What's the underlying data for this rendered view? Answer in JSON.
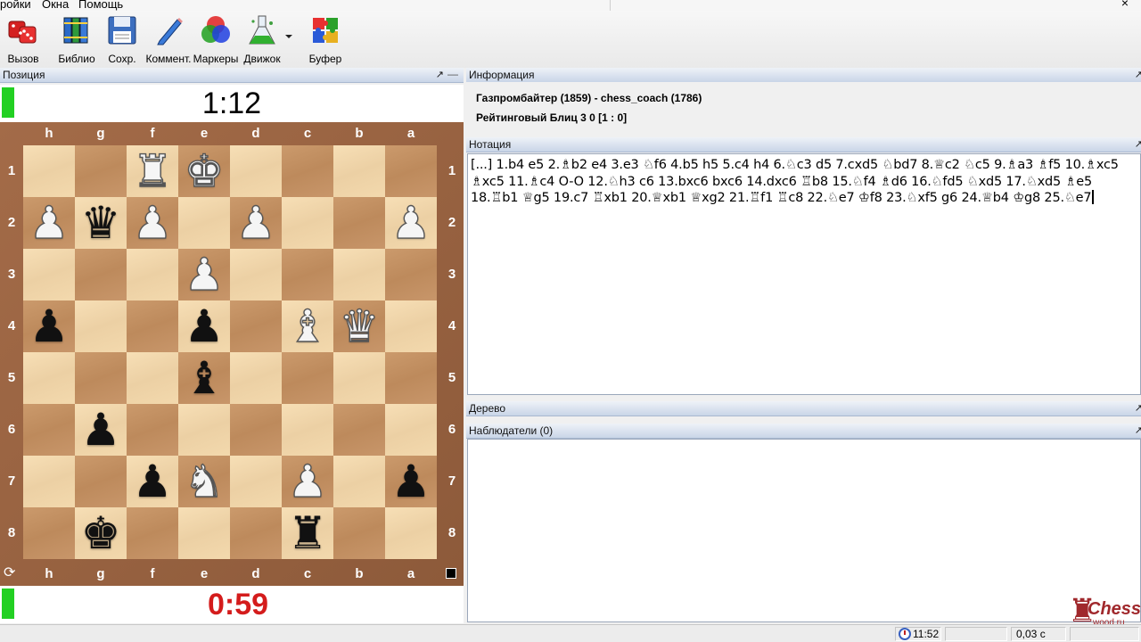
{
  "menu": {
    "items": [
      "ройки",
      "Окна",
      "Помощь"
    ],
    "close_symbol": "×"
  },
  "toolbar": {
    "buttons": [
      {
        "label": "Вызов",
        "icon": "dice-icon"
      },
      {
        "label": "Библио",
        "icon": "books-icon"
      },
      {
        "label": "Сохр.",
        "icon": "floppy-disk-icon"
      },
      {
        "label": "Коммент.",
        "icon": "pencil-icon"
      },
      {
        "label": "Маркеры",
        "icon": "color-circles-icon"
      },
      {
        "label": "Движок",
        "icon": "flask-icon"
      },
      {
        "label": "Буфер",
        "icon": "puzzle-icon"
      }
    ]
  },
  "position_panel": {
    "title": "Позиция",
    "pin_symbol": "↗",
    "clock_top": "1:12",
    "clock_bottom": "0:59",
    "files": [
      "h",
      "g",
      "f",
      "e",
      "d",
      "c",
      "b",
      "a"
    ],
    "ranks": [
      "1",
      "2",
      "3",
      "4",
      "5",
      "6",
      "7",
      "8"
    ],
    "pieces": [
      {
        "square": "f1",
        "color": "w",
        "type": "rook",
        "glyph": "♜"
      },
      {
        "square": "e1",
        "color": "w",
        "type": "king",
        "glyph": "♚"
      },
      {
        "square": "h2",
        "color": "w",
        "type": "pawn",
        "glyph": "♟"
      },
      {
        "square": "g2",
        "color": "b",
        "type": "queen",
        "glyph": "♛"
      },
      {
        "square": "f2",
        "color": "w",
        "type": "pawn",
        "glyph": "♟"
      },
      {
        "square": "d2",
        "color": "w",
        "type": "pawn",
        "glyph": "♟"
      },
      {
        "square": "a2",
        "color": "w",
        "type": "pawn",
        "glyph": "♟"
      },
      {
        "square": "e3",
        "color": "w",
        "type": "pawn",
        "glyph": "♟"
      },
      {
        "square": "h4",
        "color": "b",
        "type": "pawn",
        "glyph": "♟"
      },
      {
        "square": "e4",
        "color": "b",
        "type": "pawn",
        "glyph": "♟"
      },
      {
        "square": "c4",
        "color": "w",
        "type": "bishop",
        "glyph": "♝"
      },
      {
        "square": "b4",
        "color": "w",
        "type": "queen",
        "glyph": "♛"
      },
      {
        "square": "e5",
        "color": "b",
        "type": "bishop",
        "glyph": "♝"
      },
      {
        "square": "g6",
        "color": "b",
        "type": "pawn",
        "glyph": "♟"
      },
      {
        "square": "f7",
        "color": "b",
        "type": "pawn",
        "glyph": "♟"
      },
      {
        "square": "e7",
        "color": "w",
        "type": "knight",
        "glyph": "♞"
      },
      {
        "square": "c7",
        "color": "w",
        "type": "pawn",
        "glyph": "♟"
      },
      {
        "square": "a7",
        "color": "b",
        "type": "pawn",
        "glyph": "♟"
      },
      {
        "square": "g8",
        "color": "b",
        "type": "king",
        "glyph": "♚"
      },
      {
        "square": "c8",
        "color": "b",
        "type": "rook",
        "glyph": "♜"
      }
    ]
  },
  "info_panel": {
    "title": "Информация",
    "players": "Газпромбайтер (1859) - chess_coach (1786)",
    "event": "Рейтинговый Блиц 3 0 [1 : 0]"
  },
  "notation_panel": {
    "title": "Нотация",
    "text": "[...] 1.b4 e5 2.♗b2 e4 3.e3 ♘f6 4.b5 h5 5.c4 h4 6.♘c3 d5 7.cxd5 ♘bd7 8.♕c2 ♘c5 9.♗a3 ♗f5 10.♗xc5 ♗xc5 11.♗c4 O-O 12.♘h3 c6 13.bxc6 bxc6 14.dxc6 ♖b8 15.♘f4 ♗d6 16.♘fd5 ♘xd5 17.♘xd5 ♗e5 18.♖b1 ♕g5 19.c7 ♖xb1 20.♕xb1 ♕xg2 21.♖f1 ♖c8 22.♘e7 ♔f8 23.♘xf5 g6 24.♕b4 ♔g8 25.♘e7"
  },
  "tree_panel": {
    "title": "Дерево"
  },
  "watchers_panel": {
    "title": "Наблюдатели (0)"
  },
  "logo": {
    "text_main": "Chess",
    "text_sub": "wood.ru"
  },
  "statusbar": {
    "time": "11:52",
    "lag": "0,03 с"
  }
}
